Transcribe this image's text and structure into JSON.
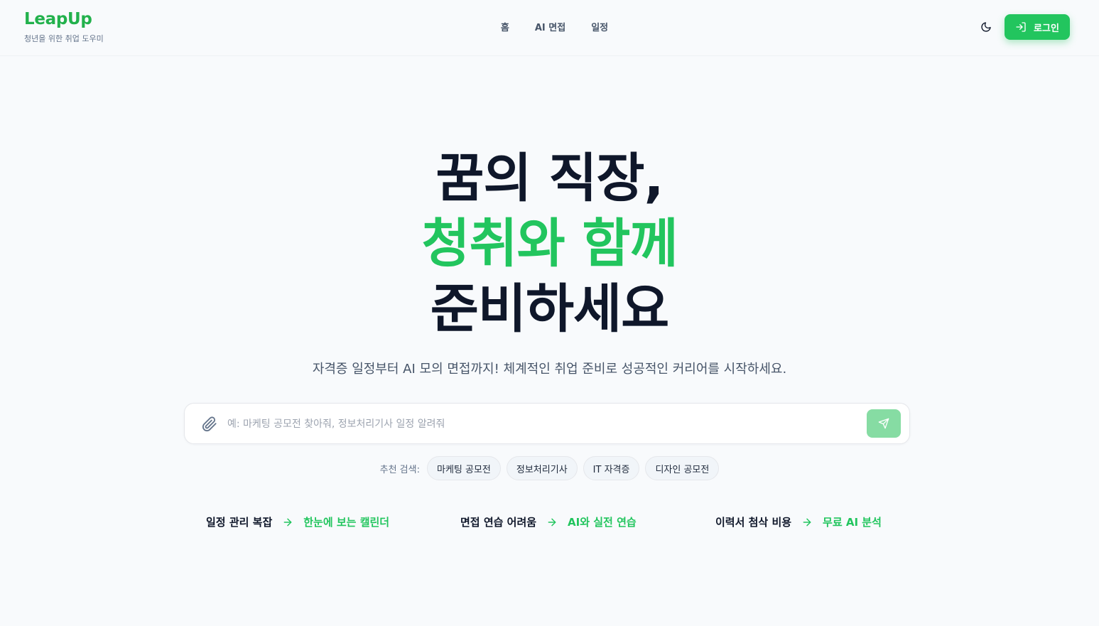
{
  "brand": {
    "name": "LeapUp",
    "tagline": "청년을 위한 취업 도우미",
    "accent": "#22c55e"
  },
  "nav": {
    "items": [
      {
        "label": "홈"
      },
      {
        "label": "AI 면접"
      },
      {
        "label": "일정"
      }
    ]
  },
  "header": {
    "theme_icon": "moon-icon",
    "login_label": "로그인",
    "login_icon": "sign-in-icon"
  },
  "hero": {
    "line1": "꿈의 직장,",
    "line2": "청취와 함께",
    "line3": "준비하세요"
  },
  "subtitle": "자격증 일정부터 AI 모의 면접까지! 체계적인 취업 준비로 성공적인 커리어를 시작하세요.",
  "search": {
    "placeholder": "예: 마케팅 공모전 찾아줘, 정보처리기사 일정 알려줘",
    "value": "",
    "attach_icon": "paperclip-icon",
    "send_icon": "send-icon"
  },
  "suggestions": {
    "label": "추천 검색:",
    "chips": [
      "마케팅 공모전",
      "정보처리기사",
      "IT 자격증",
      "디자인 공모전"
    ]
  },
  "features": [
    {
      "problem": "일정 관리 복잡",
      "solution": "한눈에 보는 캘린더"
    },
    {
      "problem": "면접 연습 어려움",
      "solution": "AI와 실전 연습"
    },
    {
      "problem": "이력서 첨삭 비용",
      "solution": "무료 AI 분석"
    }
  ]
}
